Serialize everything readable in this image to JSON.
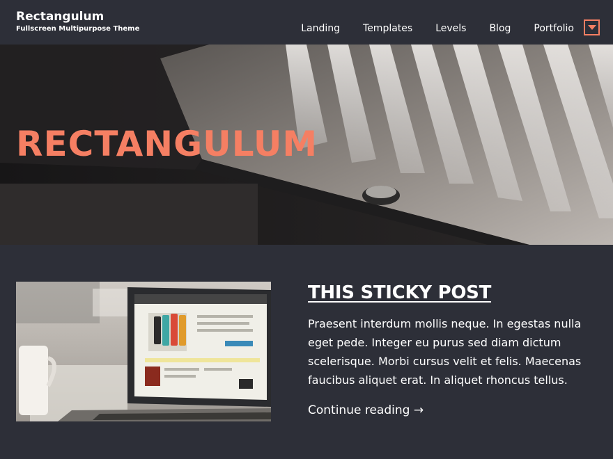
{
  "header": {
    "site_title": "Rectangulum",
    "tagline": "Fullscreen Multipurpose Theme",
    "nav": [
      {
        "label": "Landing"
      },
      {
        "label": "Templates"
      },
      {
        "label": "Levels"
      },
      {
        "label": "Blog"
      },
      {
        "label": "Portfolio"
      }
    ],
    "menu_toggle_icon": "caret-down-icon"
  },
  "hero": {
    "title": "RECTANGULUM"
  },
  "post": {
    "title": "THIS STICKY POST",
    "excerpt": "Praesent interdum mollis neque. In egestas nulla eget pede. Integer eu purus sed diam dictum scelerisque. Morbi cursus velit et felis. Maecenas faucibus aliquet erat. In aliquet rhoncus tellus.",
    "read_more": "Continue reading →",
    "thumbnail_icon": "laptop-image"
  },
  "colors": {
    "background": "#2d2f38",
    "accent": "#f57f63",
    "text": "#ffffff"
  }
}
